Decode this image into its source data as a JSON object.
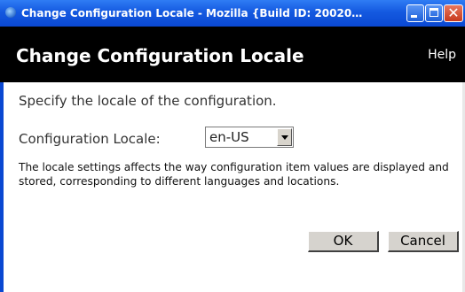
{
  "window": {
    "title": "Change Configuration Locale - Mozilla {Build ID: 20020…",
    "minimize_label": "",
    "maximize_label": "",
    "close_label": "✕"
  },
  "header": {
    "title": "Change Configuration Locale",
    "help": "Help"
  },
  "form": {
    "instruction": "Specify the locale of the configuration.",
    "locale_label": "Configuration Locale:",
    "locale_value": "en-US",
    "description": "The locale settings affects the way configuration item values are displayed and stored, corresponding to different languages and locations."
  },
  "buttons": {
    "ok": "OK",
    "cancel": "Cancel"
  }
}
